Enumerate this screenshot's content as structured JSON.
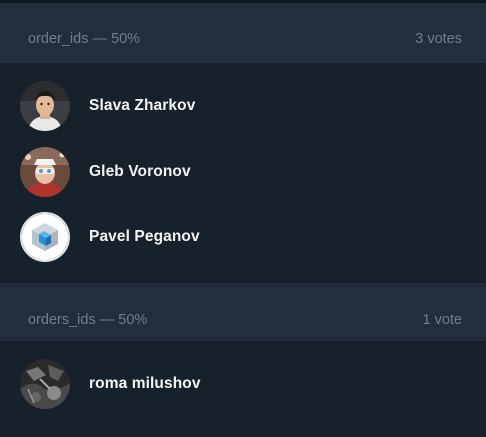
{
  "options": [
    {
      "title": "order_ids — 50%",
      "votes": "3 votes",
      "voters": [
        {
          "name": "Slava Zharkov",
          "avatar": "photo-avatar-icon"
        },
        {
          "name": "Gleb Voronov",
          "avatar": "photo-avatar-icon"
        },
        {
          "name": "Pavel Peganov",
          "avatar": "cube-logo-avatar-icon"
        }
      ]
    },
    {
      "title": "orders_ids — 50%",
      "votes": "1 vote",
      "voters": [
        {
          "name": "roma milushov",
          "avatar": "photo-avatar-icon"
        }
      ]
    }
  ],
  "colors": {
    "background": "#17212b",
    "header_background": "#232e3c",
    "header_text": "#6d7f8f",
    "name_text": "#f5f5f5"
  }
}
